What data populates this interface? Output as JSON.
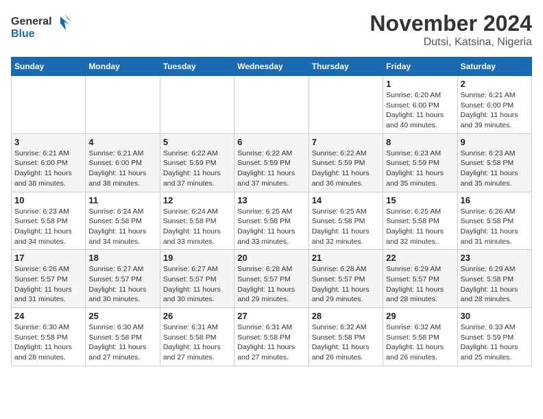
{
  "logo": {
    "text_general": "General",
    "text_blue": "Blue"
  },
  "title": "November 2024",
  "location": "Dutsi, Katsina, Nigeria",
  "days_of_week": [
    "Sunday",
    "Monday",
    "Tuesday",
    "Wednesday",
    "Thursday",
    "Friday",
    "Saturday"
  ],
  "weeks": [
    [
      {
        "day": "",
        "sunrise": "",
        "sunset": "",
        "daylight": ""
      },
      {
        "day": "",
        "sunrise": "",
        "sunset": "",
        "daylight": ""
      },
      {
        "day": "",
        "sunrise": "",
        "sunset": "",
        "daylight": ""
      },
      {
        "day": "",
        "sunrise": "",
        "sunset": "",
        "daylight": ""
      },
      {
        "day": "",
        "sunrise": "",
        "sunset": "",
        "daylight": ""
      },
      {
        "day": "1",
        "sunrise": "Sunrise: 6:20 AM",
        "sunset": "Sunset: 6:00 PM",
        "daylight": "Daylight: 11 hours and 40 minutes."
      },
      {
        "day": "2",
        "sunrise": "Sunrise: 6:21 AM",
        "sunset": "Sunset: 6:00 PM",
        "daylight": "Daylight: 11 hours and 39 minutes."
      }
    ],
    [
      {
        "day": "3",
        "sunrise": "Sunrise: 6:21 AM",
        "sunset": "Sunset: 6:00 PM",
        "daylight": "Daylight: 11 hours and 38 minutes."
      },
      {
        "day": "4",
        "sunrise": "Sunrise: 6:21 AM",
        "sunset": "Sunset: 6:00 PM",
        "daylight": "Daylight: 11 hours and 38 minutes."
      },
      {
        "day": "5",
        "sunrise": "Sunrise: 6:22 AM",
        "sunset": "Sunset: 5:59 PM",
        "daylight": "Daylight: 11 hours and 37 minutes."
      },
      {
        "day": "6",
        "sunrise": "Sunrise: 6:22 AM",
        "sunset": "Sunset: 5:59 PM",
        "daylight": "Daylight: 11 hours and 37 minutes."
      },
      {
        "day": "7",
        "sunrise": "Sunrise: 6:22 AM",
        "sunset": "Sunset: 5:59 PM",
        "daylight": "Daylight: 11 hours and 36 minutes."
      },
      {
        "day": "8",
        "sunrise": "Sunrise: 6:23 AM",
        "sunset": "Sunset: 5:59 PM",
        "daylight": "Daylight: 11 hours and 35 minutes."
      },
      {
        "day": "9",
        "sunrise": "Sunrise: 6:23 AM",
        "sunset": "Sunset: 5:58 PM",
        "daylight": "Daylight: 11 hours and 35 minutes."
      }
    ],
    [
      {
        "day": "10",
        "sunrise": "Sunrise: 6:23 AM",
        "sunset": "Sunset: 5:58 PM",
        "daylight": "Daylight: 11 hours and 34 minutes."
      },
      {
        "day": "11",
        "sunrise": "Sunrise: 6:24 AM",
        "sunset": "Sunset: 5:58 PM",
        "daylight": "Daylight: 11 hours and 34 minutes."
      },
      {
        "day": "12",
        "sunrise": "Sunrise: 6:24 AM",
        "sunset": "Sunset: 5:58 PM",
        "daylight": "Daylight: 11 hours and 33 minutes."
      },
      {
        "day": "13",
        "sunrise": "Sunrise: 6:25 AM",
        "sunset": "Sunset: 5:58 PM",
        "daylight": "Daylight: 11 hours and 33 minutes."
      },
      {
        "day": "14",
        "sunrise": "Sunrise: 6:25 AM",
        "sunset": "Sunset: 5:58 PM",
        "daylight": "Daylight: 11 hours and 32 minutes."
      },
      {
        "day": "15",
        "sunrise": "Sunrise: 6:25 AM",
        "sunset": "Sunset: 5:58 PM",
        "daylight": "Daylight: 11 hours and 32 minutes."
      },
      {
        "day": "16",
        "sunrise": "Sunrise: 6:26 AM",
        "sunset": "Sunset: 5:58 PM",
        "daylight": "Daylight: 11 hours and 31 minutes."
      }
    ],
    [
      {
        "day": "17",
        "sunrise": "Sunrise: 6:26 AM",
        "sunset": "Sunset: 5:57 PM",
        "daylight": "Daylight: 11 hours and 31 minutes."
      },
      {
        "day": "18",
        "sunrise": "Sunrise: 6:27 AM",
        "sunset": "Sunset: 5:57 PM",
        "daylight": "Daylight: 11 hours and 30 minutes."
      },
      {
        "day": "19",
        "sunrise": "Sunrise: 6:27 AM",
        "sunset": "Sunset: 5:57 PM",
        "daylight": "Daylight: 11 hours and 30 minutes."
      },
      {
        "day": "20",
        "sunrise": "Sunrise: 6:28 AM",
        "sunset": "Sunset: 5:57 PM",
        "daylight": "Daylight: 11 hours and 29 minutes."
      },
      {
        "day": "21",
        "sunrise": "Sunrise: 6:28 AM",
        "sunset": "Sunset: 5:57 PM",
        "daylight": "Daylight: 11 hours and 29 minutes."
      },
      {
        "day": "22",
        "sunrise": "Sunrise: 6:29 AM",
        "sunset": "Sunset: 5:57 PM",
        "daylight": "Daylight: 11 hours and 28 minutes."
      },
      {
        "day": "23",
        "sunrise": "Sunrise: 6:29 AM",
        "sunset": "Sunset: 5:58 PM",
        "daylight": "Daylight: 11 hours and 28 minutes."
      }
    ],
    [
      {
        "day": "24",
        "sunrise": "Sunrise: 6:30 AM",
        "sunset": "Sunset: 5:58 PM",
        "daylight": "Daylight: 11 hours and 28 minutes."
      },
      {
        "day": "25",
        "sunrise": "Sunrise: 6:30 AM",
        "sunset": "Sunset: 5:58 PM",
        "daylight": "Daylight: 11 hours and 27 minutes."
      },
      {
        "day": "26",
        "sunrise": "Sunrise: 6:31 AM",
        "sunset": "Sunset: 5:58 PM",
        "daylight": "Daylight: 11 hours and 27 minutes."
      },
      {
        "day": "27",
        "sunrise": "Sunrise: 6:31 AM",
        "sunset": "Sunset: 5:58 PM",
        "daylight": "Daylight: 11 hours and 27 minutes."
      },
      {
        "day": "28",
        "sunrise": "Sunrise: 6:32 AM",
        "sunset": "Sunset: 5:58 PM",
        "daylight": "Daylight: 11 hours and 26 minutes."
      },
      {
        "day": "29",
        "sunrise": "Sunrise: 6:32 AM",
        "sunset": "Sunset: 5:58 PM",
        "daylight": "Daylight: 11 hours and 26 minutes."
      },
      {
        "day": "30",
        "sunrise": "Sunrise: 6:33 AM",
        "sunset": "Sunset: 5:59 PM",
        "daylight": "Daylight: 11 hours and 25 minutes."
      }
    ]
  ]
}
